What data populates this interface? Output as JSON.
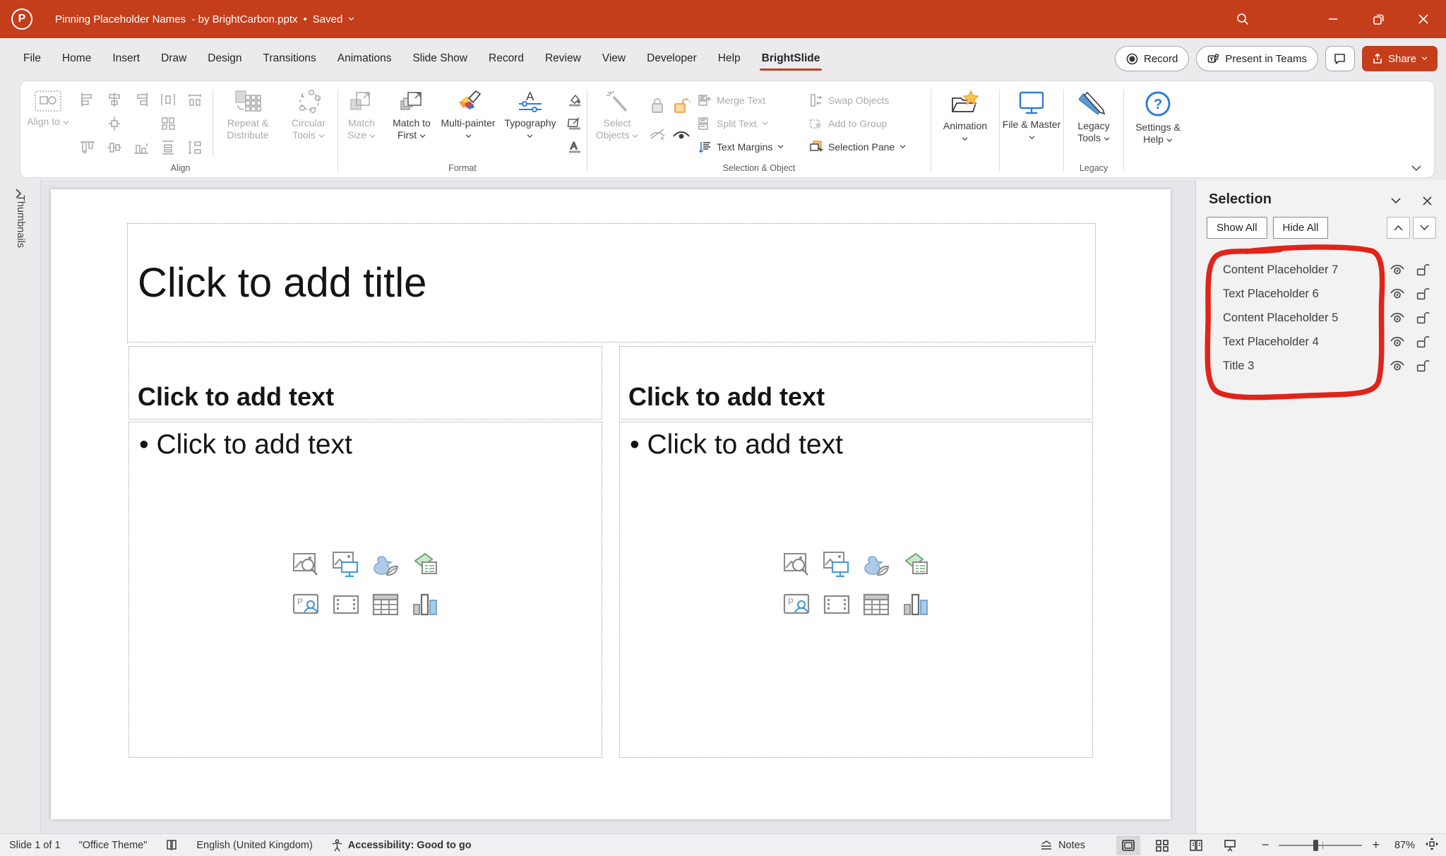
{
  "titlebar": {
    "app": "PowerPoint",
    "title": "Pinning Placeholder Names  - by BrightCarbon.pptx",
    "separator": "•",
    "saved": "Saved"
  },
  "menubar": {
    "items": [
      "File",
      "Home",
      "Insert",
      "Draw",
      "Design",
      "Transitions",
      "Animations",
      "Slide Show",
      "Record",
      "Review",
      "View",
      "Developer",
      "Help",
      "BrightSlide"
    ],
    "active_item": "BrightSlide",
    "record_label": "Record",
    "teams_label": "Present in Teams",
    "share_label": "Share"
  },
  "ribbon": {
    "groups": {
      "align": "Align",
      "format": "Format",
      "selection": "Selection & Object",
      "legacy": "Legacy"
    },
    "align_to": "Align to",
    "repeat_distribute": "Repeat & Distribute",
    "circular_tools": "Circular Tools",
    "match_size": "Match Size",
    "match_to_first": "Match to First",
    "multi_painter": "Multi-painter",
    "typography": "Typography",
    "select_objects": "Select Objects",
    "merge_text": "Merge Text",
    "split_text": "Split Text",
    "text_margins": "Text Margins",
    "swap_objects": "Swap Objects",
    "add_to_group": "Add to Group",
    "selection_pane": "Selection Pane",
    "animation": "Animation",
    "file_master": "File & Master",
    "legacy_tools": "Legacy Tools",
    "settings_help": "Settings & Help"
  },
  "thumbnails": {
    "label": "Thumbnails"
  },
  "slide": {
    "title_placeholder": "Click to add title",
    "left_column": {
      "header": "Click to add text",
      "bullet": "Click to add text"
    },
    "right_column": {
      "header": "Click to add text",
      "bullet": "Click to add text"
    }
  },
  "selection_pane": {
    "title": "Selection",
    "show_all": "Show All",
    "hide_all": "Hide All",
    "items": [
      {
        "name": "Content Placeholder 7",
        "visible": true,
        "locked": false
      },
      {
        "name": "Text Placeholder 6",
        "visible": true,
        "locked": false
      },
      {
        "name": "Content Placeholder 5",
        "visible": true,
        "locked": false
      },
      {
        "name": "Text Placeholder 4",
        "visible": true,
        "locked": false
      },
      {
        "name": "Title 3",
        "visible": true,
        "locked": false
      }
    ]
  },
  "statusbar": {
    "slide_count": "Slide 1 of 1",
    "theme": "\"Office Theme\"",
    "language": "English (United Kingdom)",
    "accessibility": "Accessibility: Good to go",
    "notes": "Notes",
    "zoom_level": "87%"
  },
  "icons": {
    "titlebar": [
      "search-icon",
      "avatar",
      "minimize-icon",
      "restore-icon",
      "close-icon"
    ],
    "selection_row": [
      "eye-icon",
      "unlock-icon"
    ],
    "statusbar_views": [
      "normal-view-icon",
      "slide-sorter-icon",
      "reading-view-icon",
      "slideshow-icon"
    ],
    "annotation": "red-hand-drawn-circle"
  },
  "colors": {
    "titlebar_red": "#C43E1C",
    "brightslide_underline": "#C43E1C",
    "annotation_red": "#E0241A",
    "accent_blue": "#2E7CD6",
    "accent_orange": "#F2A93B"
  }
}
